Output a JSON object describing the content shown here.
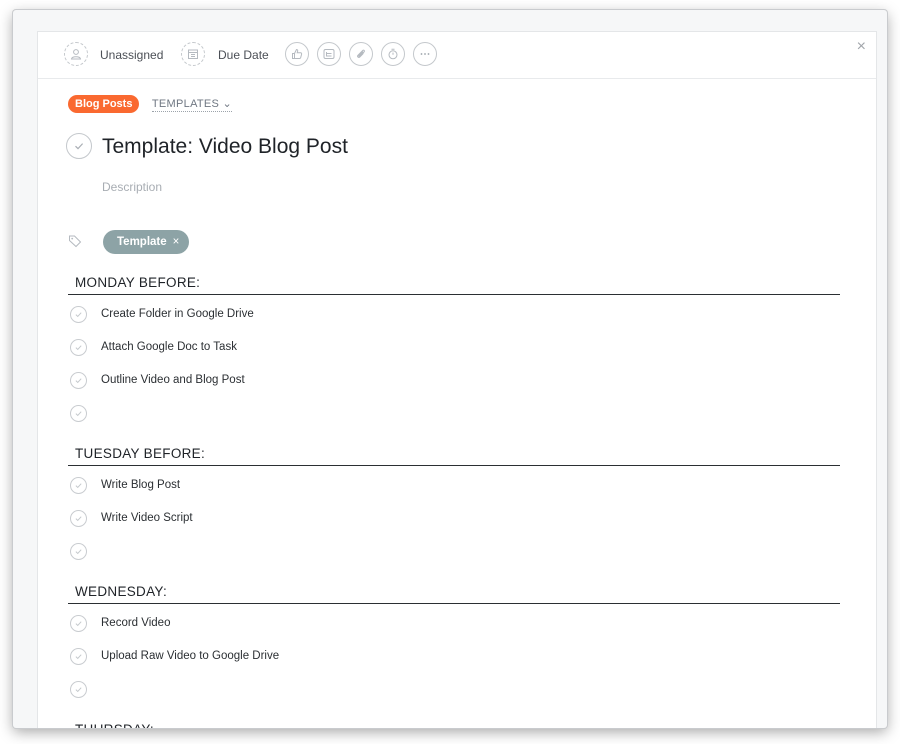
{
  "toolbar": {
    "assignee_label": "Unassigned",
    "due_date_label": "Due Date",
    "icons": [
      "user-icon",
      "calendar-icon",
      "like-icon",
      "subtask-icon",
      "attachment-icon",
      "timer-icon",
      "more-icon",
      "close-icon"
    ],
    "close_glyph": "×"
  },
  "project": {
    "badge": "Blog Posts",
    "templates_link": "TEMPLATES ⌄",
    "badge_color": "#fa6930"
  },
  "task": {
    "title": "Template: Video Blog Post",
    "description_placeholder": "Description"
  },
  "tags": {
    "label": "Template",
    "remove_glyph": "×",
    "color": "#8da3a6"
  },
  "sections": [
    {
      "header": "MONDAY BEFORE:",
      "items": [
        "Create Folder in Google Drive",
        "Attach Google Doc to Task",
        "Outline Video and Blog Post",
        ""
      ]
    },
    {
      "header": "TUESDAY BEFORE:",
      "items": [
        "Write Blog Post",
        "Write Video Script",
        ""
      ]
    },
    {
      "header": "WEDNESDAY:",
      "items": [
        "Record Video",
        "Upload Raw Video to Google Drive",
        ""
      ]
    },
    {
      "header": "THURSDAY:",
      "items": []
    }
  ]
}
